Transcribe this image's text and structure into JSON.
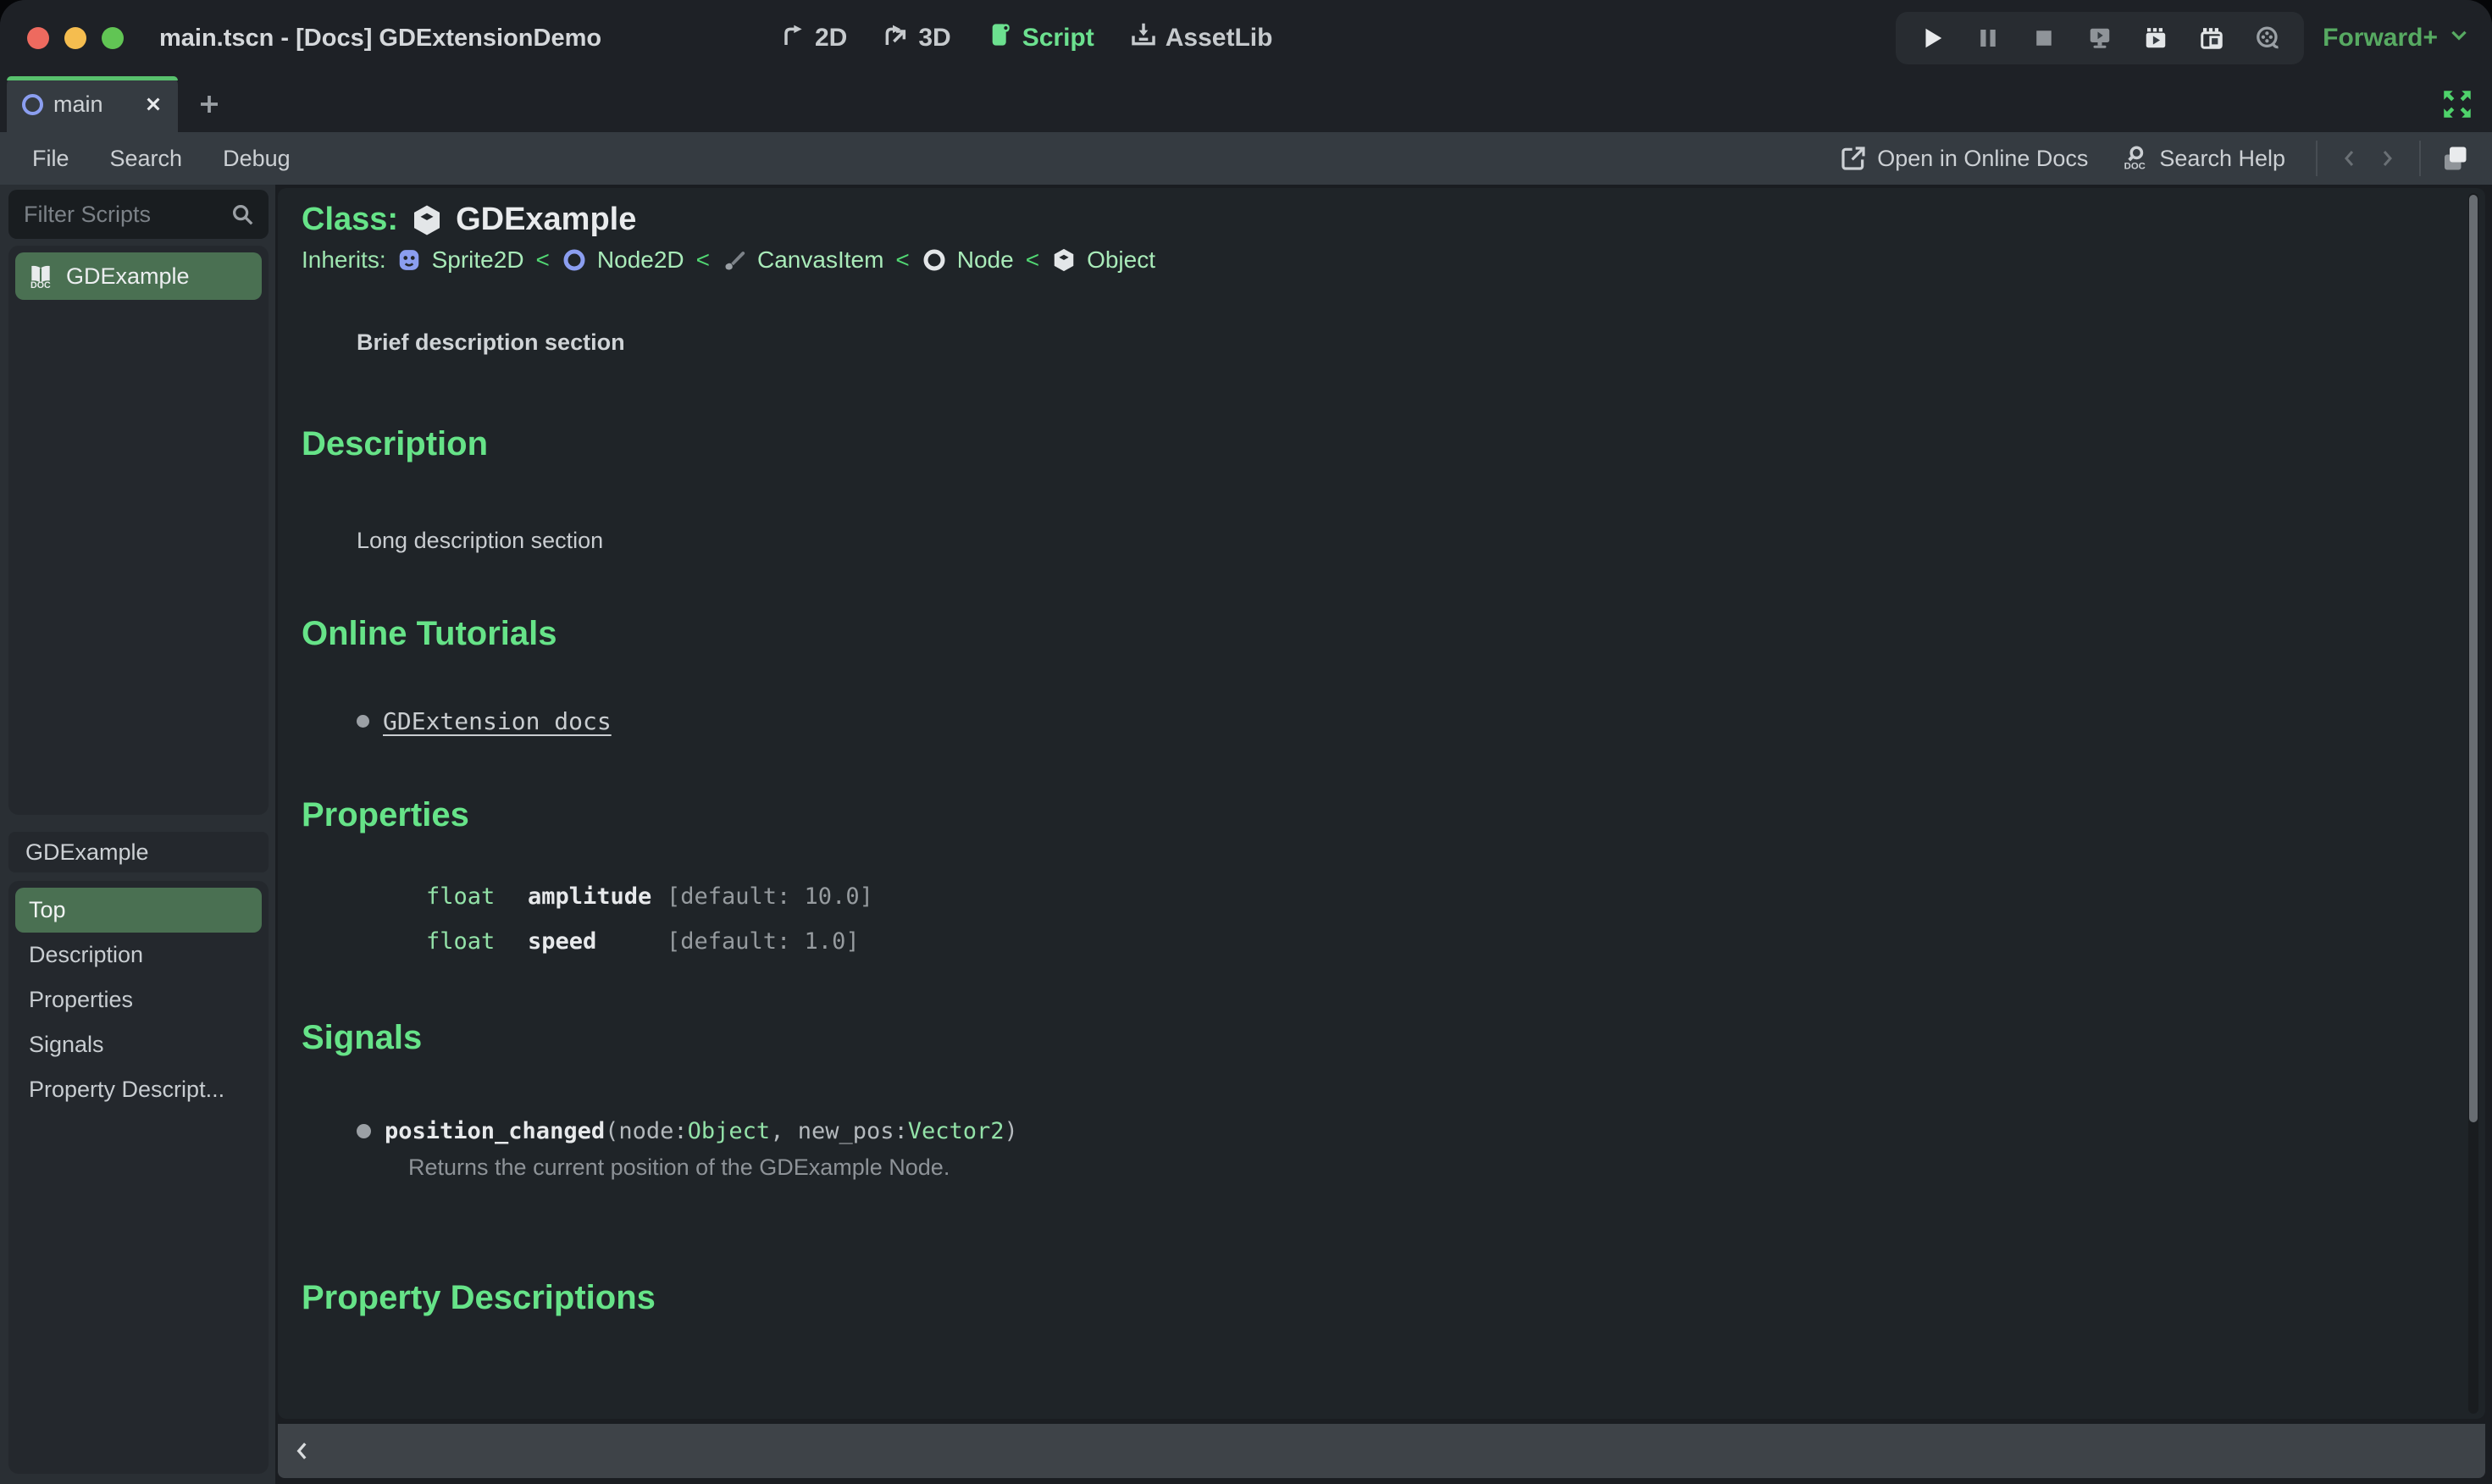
{
  "window": {
    "title": "main.tscn - [Docs] GDExtensionDemo"
  },
  "titlebar": {
    "workspaces": {
      "w2d": "2D",
      "w3d": "3D",
      "script": "Script",
      "assetlib": "AssetLib"
    },
    "renderer": "Forward+"
  },
  "tabstrip": {
    "scene_tab": "main"
  },
  "menubar": {
    "file": "File",
    "search": "Search",
    "debug": "Debug",
    "online_docs": "Open in Online Docs",
    "search_help": "Search Help"
  },
  "sidebar": {
    "filter_placeholder": "Filter Scripts",
    "scripts": [
      {
        "name": "GDExample"
      }
    ],
    "member_header": "GDExample",
    "sections": [
      {
        "label": "Top"
      },
      {
        "label": "Description"
      },
      {
        "label": "Properties"
      },
      {
        "label": "Signals"
      },
      {
        "label": "Property Descript..."
      }
    ]
  },
  "doc": {
    "class_label": "Class:",
    "class_name": "GDExample",
    "inherits_label": "Inherits:",
    "inherits_separator": "<",
    "inherits_chain": [
      {
        "name": "Sprite2D"
      },
      {
        "name": "Node2D"
      },
      {
        "name": "CanvasItem"
      },
      {
        "name": "Node"
      },
      {
        "name": "Object"
      }
    ],
    "brief": "Brief description section",
    "description_heading": "Description",
    "description_body": "Long description section",
    "tutorials_heading": "Online Tutorials",
    "tutorial_link": "GDExtension docs",
    "properties_heading": "Properties",
    "properties": [
      {
        "type": "float",
        "name": "amplitude",
        "default": "[default: 10.0]"
      },
      {
        "type": "float",
        "name": "speed",
        "default": "[default: 1.0]"
      }
    ],
    "signals_heading": "Signals",
    "signal": {
      "name": "position_changed",
      "open": "(node: ",
      "type1": "Object",
      "mid": ", new_pos: ",
      "type2": "Vector2",
      "close": ")",
      "description": "Returns the current position of the GDExample Node."
    },
    "property_descriptions_heading": "Property Descriptions"
  },
  "colors": {
    "accent_green": "#66e388",
    "selection_green": "#4a7052",
    "link_green": "#a9ebb9",
    "renderer_green": "#57aa62",
    "node_blue": "#8b9ef0",
    "tab_active_line": "#58c16d",
    "doc_background": "#1f2428",
    "toolbar_background": "#353b41"
  }
}
